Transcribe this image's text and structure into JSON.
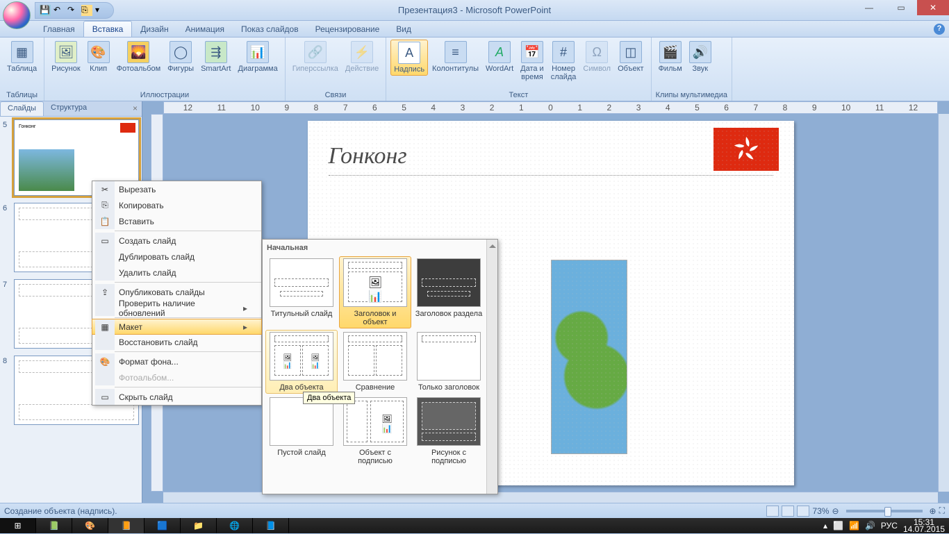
{
  "title": "Презентация3 - Microsoft PowerPoint",
  "tabs": {
    "home": "Главная",
    "insert": "Вставка",
    "design": "Дизайн",
    "anim": "Анимация",
    "show": "Показ слайдов",
    "review": "Рецензирование",
    "view": "Вид"
  },
  "ribbon": {
    "groups": {
      "tables": "Таблицы",
      "illustrations": "Иллюстрации",
      "links": "Связи",
      "text": "Текст",
      "media": "Клипы мультимедиа"
    },
    "btn": {
      "table": "Таблица",
      "picture": "Рисунок",
      "clip": "Клип",
      "album": "Фотоальбом",
      "shapes": "Фигуры",
      "smartart": "SmartArt",
      "chart": "Диаграмма",
      "link": "Гиперссылка",
      "action": "Действие",
      "textbox": "Надпись",
      "headerfooter": "Колонтитулы",
      "wordart": "WordArt",
      "datetime": "Дата и\nвремя",
      "slidenum": "Номер\nслайда",
      "symbol": "Символ",
      "object": "Объект",
      "movie": "Фильм",
      "sound": "Звук"
    }
  },
  "leftpanel": {
    "slides": "Слайды",
    "outline": "Структура"
  },
  "slide": {
    "title": "Гонконг"
  },
  "thumb5_title": "Гонконг",
  "context": {
    "cut": "Вырезать",
    "copy": "Копировать",
    "paste": "Вставить",
    "new": "Создать слайд",
    "dup": "Дублировать слайд",
    "del": "Удалить слайд",
    "publish": "Опубликовать слайды",
    "update": "Проверить наличие обновлений",
    "layout": "Макет",
    "reset": "Восстановить слайд",
    "format": "Формат фона...",
    "photoalbum": "Фотоальбом...",
    "hide": "Скрыть слайд"
  },
  "gallery": {
    "header": "Начальная",
    "l1": "Титульный слайд",
    "l2": "Заголовок и объект",
    "l3": "Заголовок раздела",
    "l4": "Два объекта",
    "l5": "Сравнение",
    "l6": "Только заголовок",
    "l7": "Пустой слайд",
    "l8": "Объект с подписью",
    "l9": "Рисунок с подписью",
    "tooltip": "Два объекта"
  },
  "status": {
    "msg": "Создание объекта (надпись).",
    "zoom": "73%"
  },
  "tray": {
    "lang": "РУС",
    "time": "15:31",
    "date": "14.07.2015"
  },
  "thumbNums": {
    "a": "5",
    "b": "6",
    "c": "7",
    "d": "8"
  }
}
